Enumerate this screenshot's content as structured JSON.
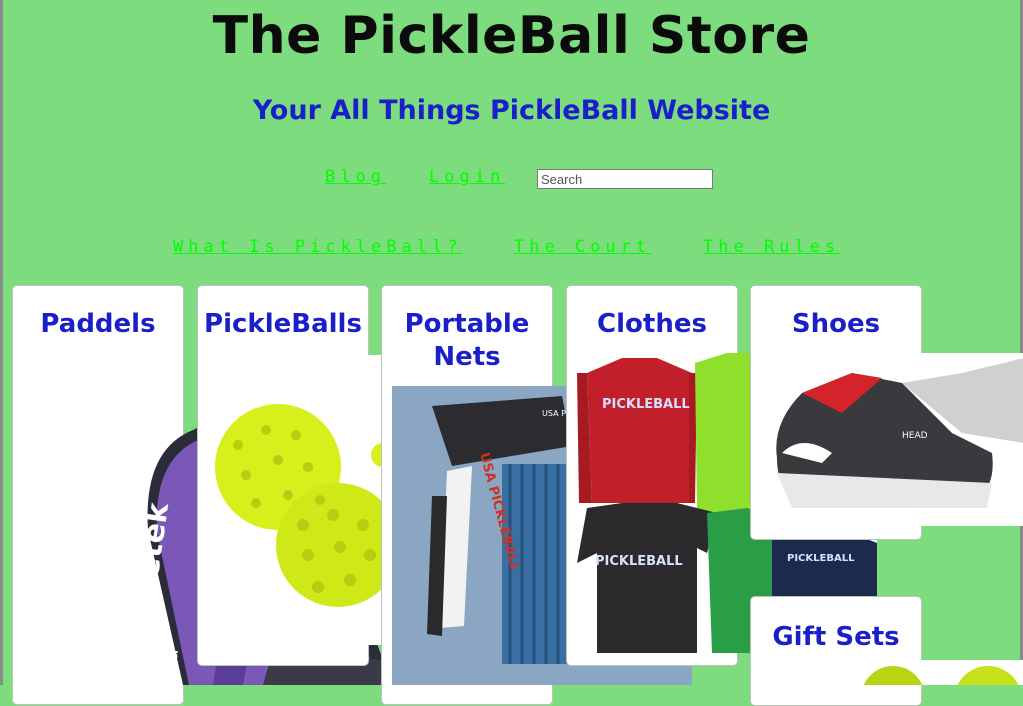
{
  "header": {
    "title": "The PickleBall Store",
    "subtitle": "Your All Things PickleBall Website"
  },
  "nav": {
    "blog": "Blog",
    "login": "Login",
    "search_placeholder": "Search"
  },
  "subnav": {
    "what_is": "What Is PickleBall?",
    "court": "The Court",
    "rules": "The Rules"
  },
  "cards": {
    "paddles": "Paddels",
    "balls": "PickleBalls",
    "nets_line1": "Portable",
    "nets_line2": "Nets",
    "clothes": "Clothes",
    "shoes": "Shoes",
    "gift_sets": "Gift Sets"
  },
  "images": {
    "paddle_brand": "paddletek",
    "net_bag_text": "USA PICKLEBALL",
    "net_banner_text": "USA PICKLEBALL",
    "shirt_text": "PICKLEBALL",
    "shoe_brand": "HEAD"
  },
  "colors": {
    "background": "#7ddc7e",
    "title": "#0b0b0b",
    "heading_blue": "#1a1fc9",
    "link_green": "#00ff00"
  }
}
